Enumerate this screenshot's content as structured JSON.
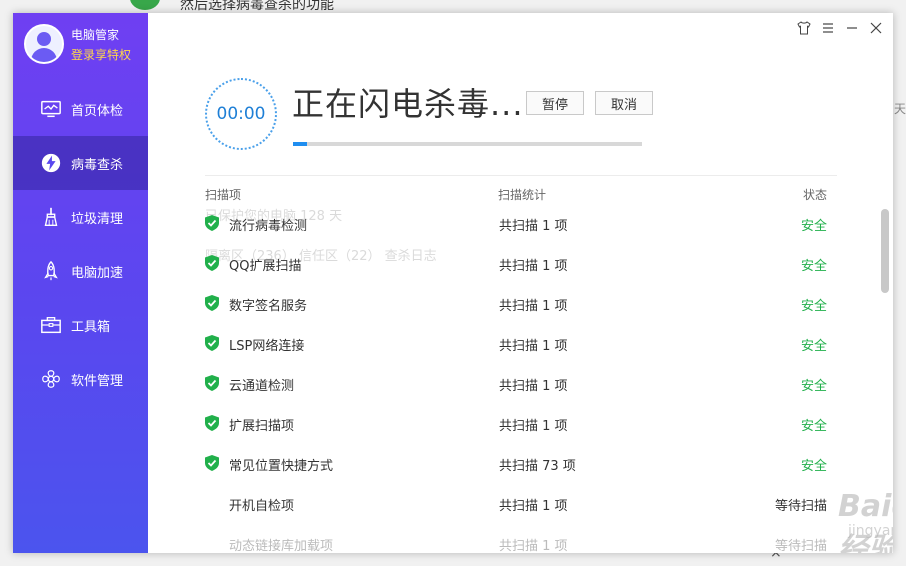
{
  "background": {
    "top_text": "然后选择病毒查杀的功能",
    "right_text": "天",
    "bottom_close": "×"
  },
  "app": {
    "user_name": "电脑管家",
    "user_privilege": "登录享特权"
  },
  "sidebar": {
    "items": [
      {
        "label": "首页体检",
        "icon": "monitor-icon",
        "active": false
      },
      {
        "label": "病毒查杀",
        "icon": "lightning-shield-icon",
        "active": true
      },
      {
        "label": "垃圾清理",
        "icon": "broom-icon",
        "active": false
      },
      {
        "label": "电脑加速",
        "icon": "rocket-icon",
        "active": false
      },
      {
        "label": "工具箱",
        "icon": "toolbox-icon",
        "active": false
      },
      {
        "label": "软件管理",
        "icon": "software-icon",
        "active": false
      }
    ]
  },
  "window_controls": [
    "skin-icon",
    "menu-icon",
    "minimize-icon",
    "close-icon"
  ],
  "scan": {
    "timer": "00:00",
    "title": "正在闪电杀毒...",
    "pause_label": "暂停",
    "cancel_label": "取消",
    "progress": 0.04
  },
  "ghost": {
    "line1": "已保护您的电脑 128 天",
    "line2": "隔离区（236）  信任区（22）  查杀日志"
  },
  "table": {
    "headers": {
      "item": "扫描项",
      "stats": "扫描统计",
      "status": "状态"
    },
    "rows": [
      {
        "name": "流行病毒检测",
        "stats": "共扫描 1 项",
        "status": "安全",
        "checked": true
      },
      {
        "name": "QQ扩展扫描",
        "stats": "共扫描 1 项",
        "status": "安全",
        "checked": true
      },
      {
        "name": "数字签名服务",
        "stats": "共扫描 1 项",
        "status": "安全",
        "checked": true
      },
      {
        "name": "LSP网络连接",
        "stats": "共扫描 1 项",
        "status": "安全",
        "checked": true
      },
      {
        "name": "云通道检测",
        "stats": "共扫描 1 项",
        "status": "安全",
        "checked": true
      },
      {
        "name": "扩展扫描项",
        "stats": "共扫描 1 项",
        "status": "安全",
        "checked": true
      },
      {
        "name": "常见位置快捷方式",
        "stats": "共扫描 73 项",
        "status": "安全",
        "checked": true
      },
      {
        "name": "开机自检项",
        "stats": "共扫描 1 项",
        "status": "等待扫描",
        "checked": false
      },
      {
        "name": "动态链接库加载项",
        "stats": "共扫描 1 项",
        "status": "等待扫描",
        "checked": false
      }
    ]
  },
  "watermark": {
    "text": "Baidu经验",
    "sub": "jingyan.baidu.com"
  },
  "colors": {
    "sidebar_top": "#6f3ff2",
    "sidebar_bottom": "#4b54ee",
    "safe_green": "#21b04b",
    "accent_blue": "#1f8ef0"
  }
}
